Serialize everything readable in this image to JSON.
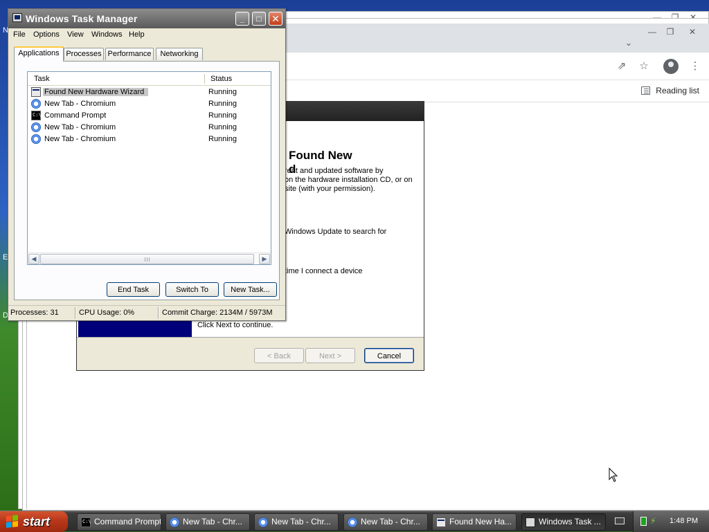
{
  "chromium": {
    "reading_list_label": "Reading list",
    "icons": [
      "share-icon",
      "star-icon",
      "profile-icon",
      "menu-dots-icon",
      "chevron-down-icon",
      "reading-list-icon"
    ]
  },
  "wizard": {
    "heading": "Found New\nd",
    "line1": "rent and updated software by\non the hardware installation CD, or on\nsite (with your permission).",
    "line2": "Windows Update to search for",
    "line3": "time I connect a device",
    "continue_text": "Click Next to continue.",
    "back_label": "< Back",
    "next_label": "Next >",
    "cancel_label": "Cancel"
  },
  "taskmgr": {
    "title": "Windows Task Manager",
    "menu": [
      "File",
      "Options",
      "View",
      "Windows",
      "Help"
    ],
    "tabs": [
      "Applications",
      "Processes",
      "Performance",
      "Networking"
    ],
    "active_tab": "Applications",
    "columns": {
      "task": "Task",
      "status": "Status"
    },
    "rows": [
      {
        "task": "Found New Hardware Wizard",
        "status": "Running",
        "icon": "wizard-icon",
        "selected": true
      },
      {
        "task": "New Tab - Chromium",
        "status": "Running",
        "icon": "chromium-icon"
      },
      {
        "task": "Command Prompt",
        "status": "Running",
        "icon": "cmd-icon"
      },
      {
        "task": "New Tab - Chromium",
        "status": "Running",
        "icon": "chromium-icon"
      },
      {
        "task": "New Tab - Chromium",
        "status": "Running",
        "icon": "chromium-icon"
      }
    ],
    "buttons": {
      "end_task": "End Task",
      "switch_to": "Switch To",
      "new_task": "New Task..."
    },
    "status_bar": {
      "processes": "Processes: 31",
      "cpu": "CPU Usage: 0%",
      "commit": "Commit Charge: 2134M / 5973M"
    }
  },
  "taskbar": {
    "start_label": "start",
    "items": [
      {
        "label": "Command Prompt",
        "icon": "cmd-icon"
      },
      {
        "label": "New Tab - Chr...",
        "icon": "chromium-icon"
      },
      {
        "label": "New Tab - Chr...",
        "icon": "chromium-icon"
      },
      {
        "label": "New Tab - Chr...",
        "icon": "chromium-icon"
      },
      {
        "label": "Found New Ha...",
        "icon": "wizard-icon"
      },
      {
        "label": "Windows Task ...",
        "icon": "taskmgr-icon",
        "active": true
      }
    ],
    "clock": "1:48 PM"
  },
  "desktop": {
    "edge_letters": [
      "N",
      "E",
      "D"
    ]
  }
}
